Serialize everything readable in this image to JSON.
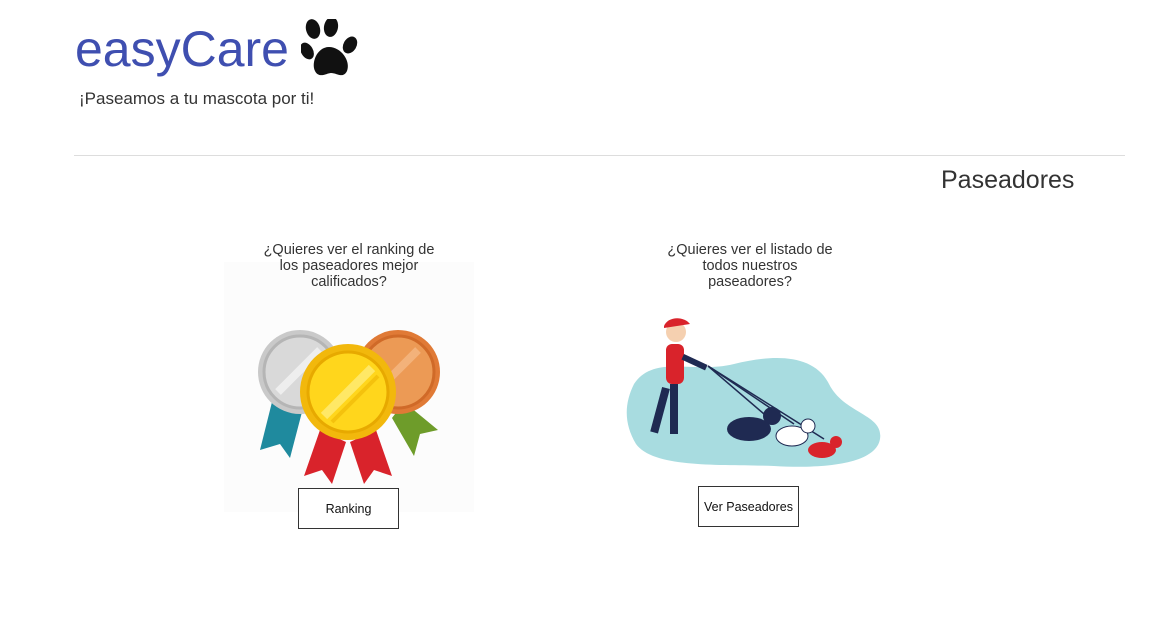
{
  "header": {
    "brand": "easyCare",
    "brand_icon": "paw-icon",
    "tagline": "¡Paseamos a tu mascota por ti!",
    "brand_color": "#3f4fb0"
  },
  "section": {
    "title": "Paseadores"
  },
  "cards": [
    {
      "question": "¿Quieres ver el ranking de los paseadores mejor calificados?",
      "illustration": "medals-illustration",
      "button_label": "Ranking"
    },
    {
      "question": "¿Quieres ver el listado de todos nuestros paseadores?",
      "illustration": "dog-walker-illustration",
      "button_label": "Ver Paseadores"
    }
  ]
}
